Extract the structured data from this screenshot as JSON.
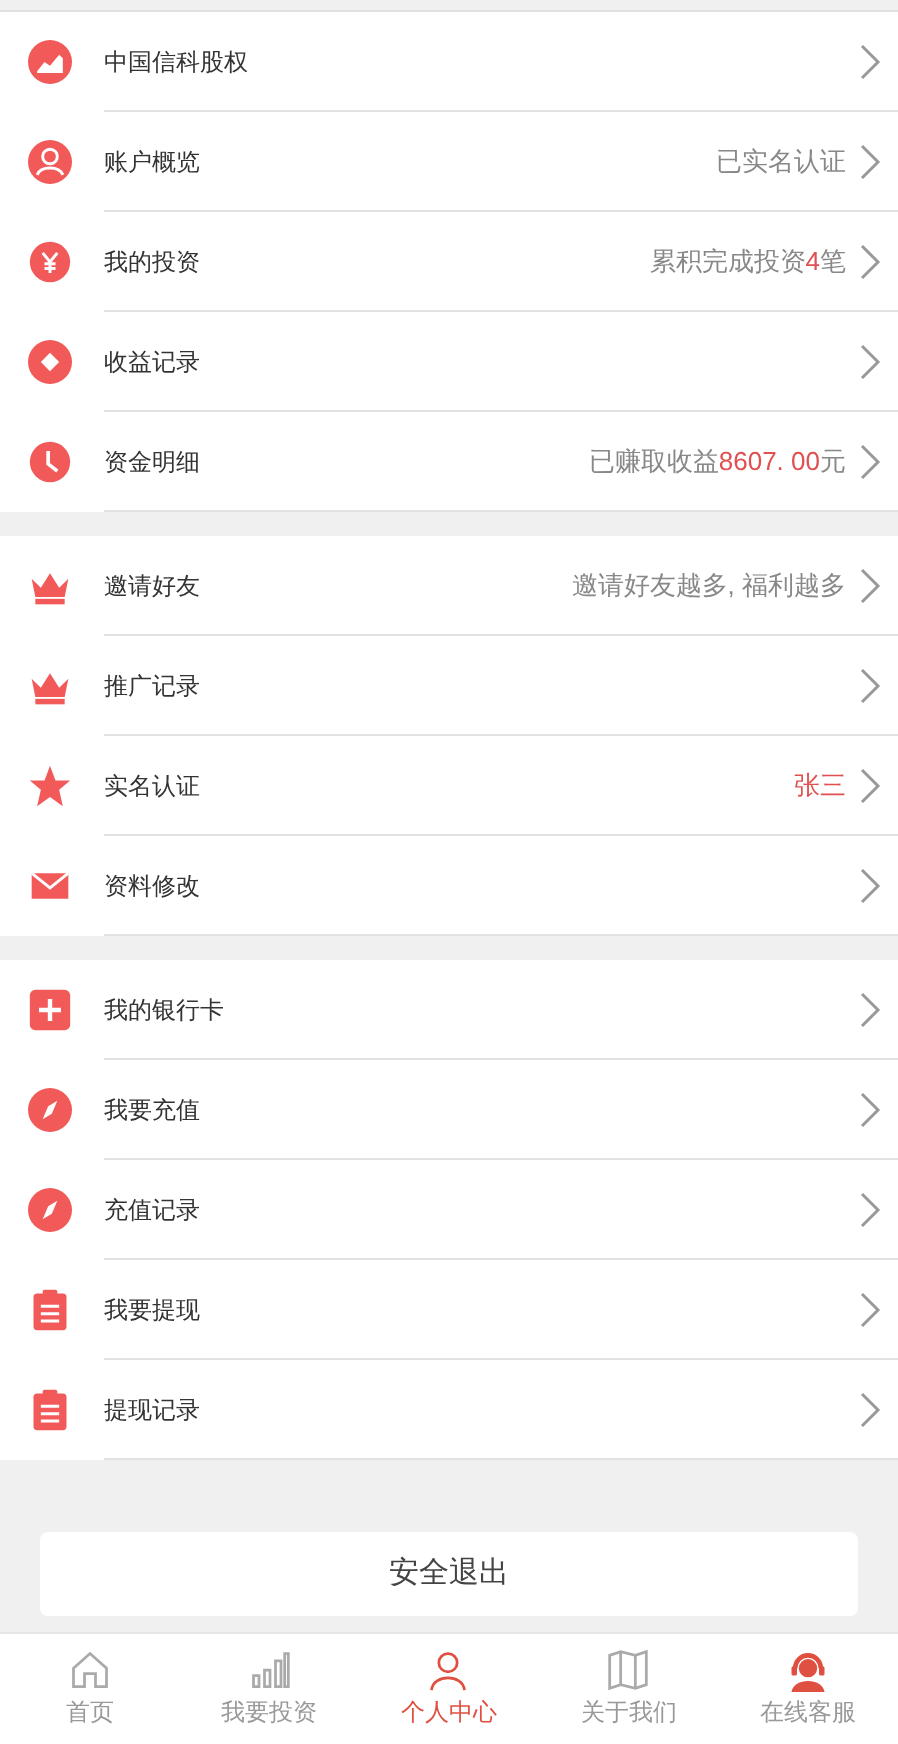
{
  "sections": [
    {
      "items": [
        {
          "kind": "chart",
          "label": "中国信科股权"
        },
        {
          "kind": "user",
          "label": "账户概览",
          "note": [
            {
              "text": "已实名认证",
              "highlight": false
            }
          ]
        },
        {
          "kind": "yen",
          "label": "我的投资",
          "note": [
            {
              "text": "累积完成投资",
              "highlight": false
            },
            {
              "text": "4",
              "highlight": true
            },
            {
              "text": "笔",
              "highlight": false
            }
          ]
        },
        {
          "kind": "diamond",
          "label": "收益记录"
        },
        {
          "kind": "clock",
          "label": "资金明细",
          "note": [
            {
              "text": "已赚取收益",
              "highlight": false
            },
            {
              "text": "8607. 00",
              "highlight": true
            },
            {
              "text": "元",
              "highlight": false
            }
          ]
        }
      ]
    },
    {
      "items": [
        {
          "kind": "crown",
          "label": "邀请好友",
          "note": [
            {
              "text": "邀请好友越多, 福利越多",
              "highlight": false
            }
          ]
        },
        {
          "kind": "crown",
          "label": "推广记录"
        },
        {
          "kind": "star",
          "label": "实名认证",
          "note": [
            {
              "text": "张三",
              "highlight": true
            }
          ]
        },
        {
          "kind": "mail",
          "label": "资料修改"
        }
      ]
    },
    {
      "items": [
        {
          "kind": "plus",
          "label": "我的银行卡"
        },
        {
          "kind": "compass",
          "label": "我要充值"
        },
        {
          "kind": "compass",
          "label": "充值记录"
        },
        {
          "kind": "clipboard",
          "label": "我要提现"
        },
        {
          "kind": "clipboard",
          "label": "提现记录"
        }
      ]
    }
  ],
  "logout_button": "安全退出",
  "tab_bar": [
    {
      "kind": "home",
      "label": "首页",
      "selected": false
    },
    {
      "kind": "bars",
      "label": "我要投资",
      "selected": false
    },
    {
      "kind": "user",
      "label": "个人中心",
      "selected": true
    },
    {
      "kind": "map",
      "label": "关于我们",
      "selected": false
    },
    {
      "kind": "agent",
      "label": "在线客服",
      "selected": false
    }
  ]
}
